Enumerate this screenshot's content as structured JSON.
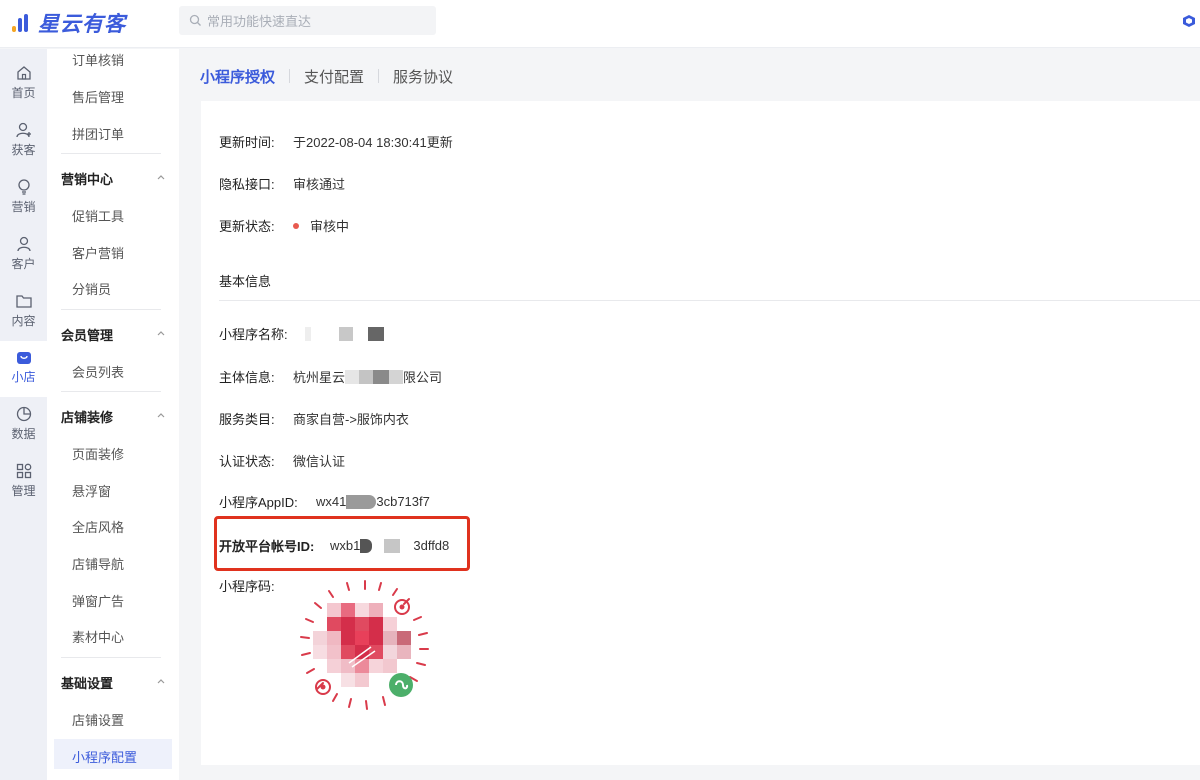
{
  "app": {
    "brand": "星云有客",
    "search_placeholder": "常用功能快速直达"
  },
  "rail": [
    {
      "label": "首页",
      "icon": "home-icon"
    },
    {
      "label": "获客",
      "icon": "add-user-icon"
    },
    {
      "label": "营销",
      "icon": "bulb-icon"
    },
    {
      "label": "客户",
      "icon": "user-icon"
    },
    {
      "label": "内容",
      "icon": "folder-icon"
    },
    {
      "label": "小店",
      "icon": "shop-icon",
      "active": true
    },
    {
      "label": "数据",
      "icon": "pie-chart-icon"
    },
    {
      "label": "管理",
      "icon": "grid-icon"
    }
  ],
  "submenu": {
    "items_top": [
      "订单核销",
      "售后管理",
      "拼团订单"
    ],
    "groups": [
      {
        "title": "营销中心",
        "items": [
          "促销工具",
          "客户营销",
          "分销员"
        ]
      },
      {
        "title": "会员管理",
        "items": [
          "会员列表"
        ]
      },
      {
        "title": "店铺装修",
        "items": [
          "页面装修",
          "悬浮窗",
          "全店风格",
          "店铺导航",
          "弹窗广告",
          "素材中心"
        ]
      },
      {
        "title": "基础设置",
        "items": [
          "店铺设置",
          "小程序配置"
        ]
      }
    ]
  },
  "tabs": [
    "小程序授权",
    "支付配置",
    "服务协议"
  ],
  "details": {
    "update_time_label": "更新时间:",
    "update_time_value": "于2022-08-04 18:30:41更新",
    "privacy_label": "隐私接口:",
    "privacy_value": "审核通过",
    "update_status_label": "更新状态:",
    "update_status_value": "审核中"
  },
  "basic_info": {
    "section_title": "基本信息",
    "name_label": "小程序名称:",
    "subject_label": "主体信息:",
    "subject_value_prefix": "杭州星云",
    "subject_value_suffix": "限公司",
    "category_label": "服务类目:",
    "category_value": "商家自营->服饰内衣",
    "auth_label": "认证状态:",
    "auth_value": "微信认证",
    "appid_label": "小程序AppID:",
    "appid_prefix": "wx41",
    "appid_suffix": "3cb713f7",
    "open_id_label": "开放平台帐号ID:",
    "open_id_prefix": "wxb1",
    "open_id_suffix": "3dffd8",
    "qr_label": "小程序码:"
  },
  "colors": {
    "accent": "#3b5bdb",
    "highlight": "#e0321e",
    "status": "#e85a4f"
  }
}
